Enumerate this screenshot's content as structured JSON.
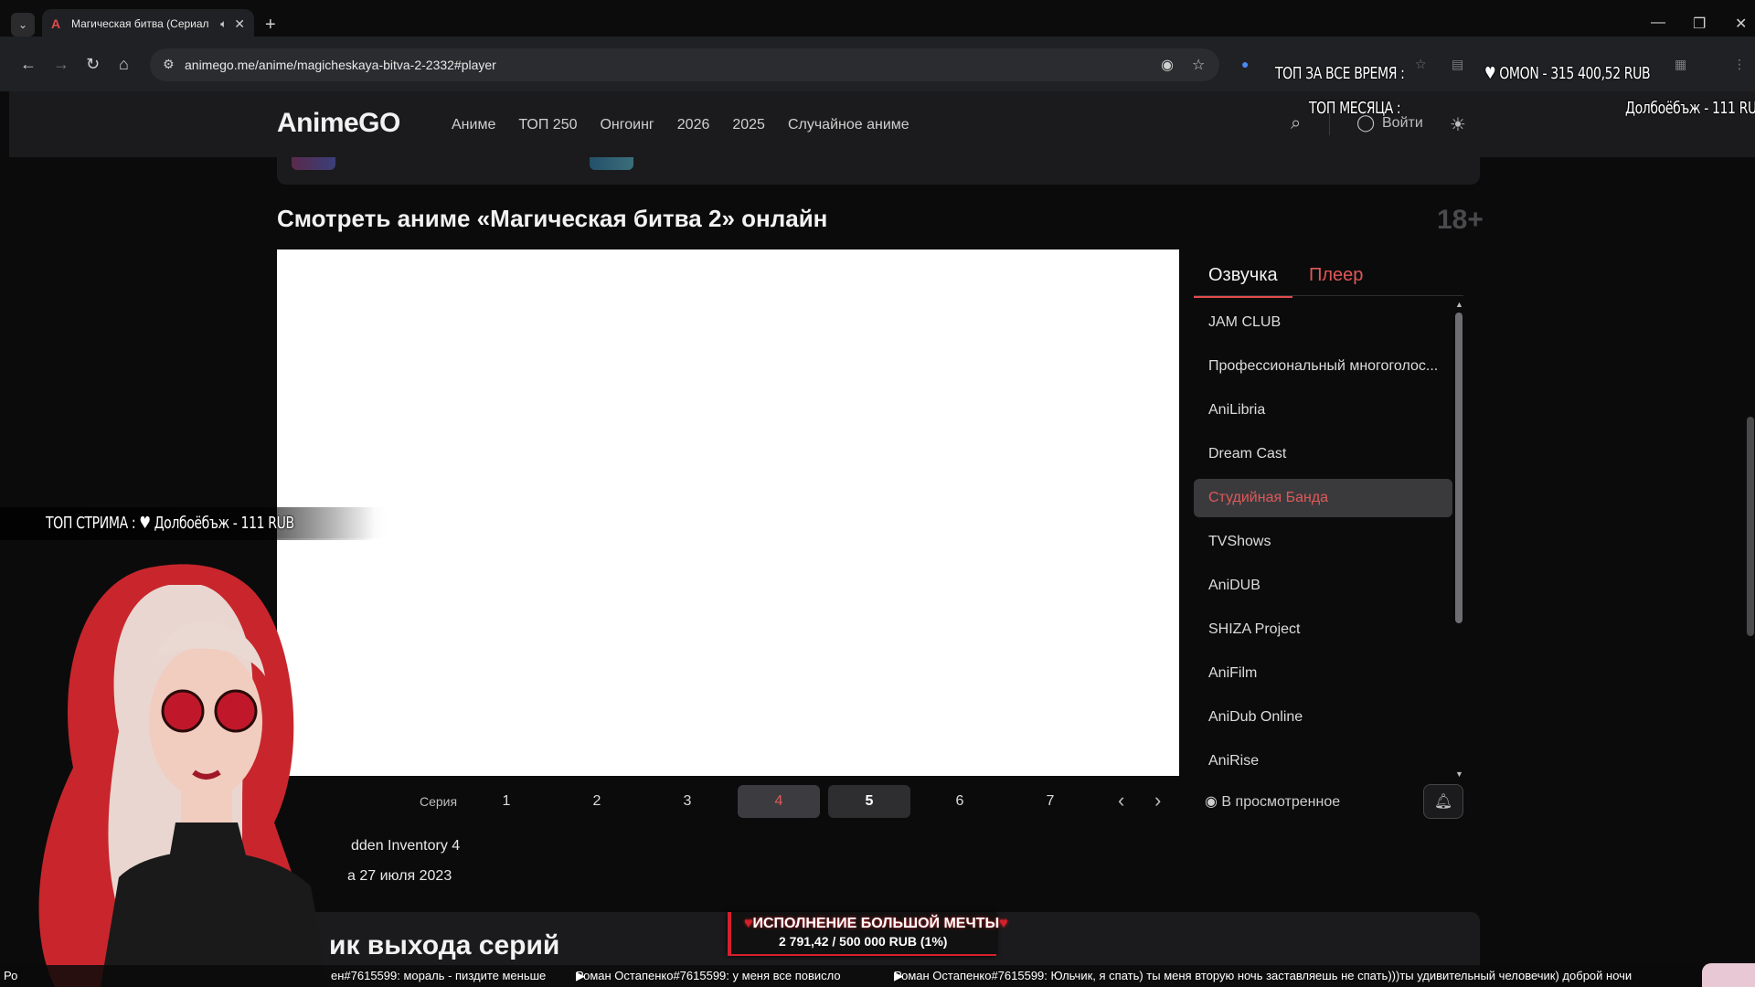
{
  "browser": {
    "tab_title": "Магическая битва (Сериал",
    "tab_favicon": "A",
    "url": "animego.me/anime/magicheskaya-bitva-2-2332#player",
    "icons": [
      "chevron-down-icon",
      "speaker-icon",
      "close-icon",
      "plus-icon",
      "back-icon",
      "forward-icon",
      "reload-icon",
      "home-icon",
      "tune-icon",
      "eye-off-icon",
      "star-icon",
      "minimize-icon",
      "restore-icon",
      "close-window-icon"
    ]
  },
  "site": {
    "logo": "AnimeGO",
    "nav": [
      "Аниме",
      "ТОП 250",
      "Онгоинг",
      "2026",
      "2025",
      "Случайное аниме"
    ],
    "login": "Войти",
    "accent_color": "#e05858"
  },
  "page": {
    "title": "Смотреть аниме «Магическая битва 2» онлайн",
    "age_rating": "18+"
  },
  "side_panel": {
    "tab_active": "Озвучка",
    "tab_other": "Плеер",
    "dubs": [
      "JAM CLUB",
      "Профессиональный многоголос...",
      "AniLibria",
      "Dream Cast",
      "Студийная Банда",
      "TVShows",
      "AniDUB",
      "SHIZA Project",
      "AniFilm",
      "AniDub Online",
      "AniRise"
    ],
    "selected_dub": "Студийная Банда"
  },
  "episodes": {
    "label": "Серия",
    "numbers": [
      "1",
      "2",
      "3",
      "4",
      "5",
      "6",
      "7"
    ],
    "current": "4",
    "hovered": "5",
    "watched_label": "В просмотренное"
  },
  "episode_info": {
    "name": "dden Inventory 4",
    "date_prefix": "а",
    "date": "27 июля 2023"
  },
  "schedule": {
    "title": "ик выхода серий"
  },
  "overlay": {
    "top_all_time_label": "ТОП ЗА ВСЕ ВРЕМЯ :",
    "top_all_time_value": "OMON - 315 400,52 RUB",
    "top_month_label": "ТОП МЕСЯЦА :",
    "top_month_value": "Долбоёбъж - 111 RUB",
    "top_stream_label": "ТОП СТРИМА :",
    "top_stream_value": "Долбоёбъж - 111 RUB",
    "goal_title": "ИСПОЛНЕНИЕ БОЛЬШОЙ МЕЧТЫ",
    "goal_progress": "2 791,42 / 500 000 RUB (1%)",
    "goal_fraction": 0.0056,
    "ticker_left": "Ро",
    "ticker_1": "ен#7615599: мораль - пиздите меньше",
    "ticker_2": "Роман Остапенко#7615599: у меня все повисло",
    "ticker_3": "Роман Остапенко#7615599: Юльчик, я спать) ты меня вторую ночь заставляешь не спать)))ты удивительный человечик) доброй ночи"
  }
}
